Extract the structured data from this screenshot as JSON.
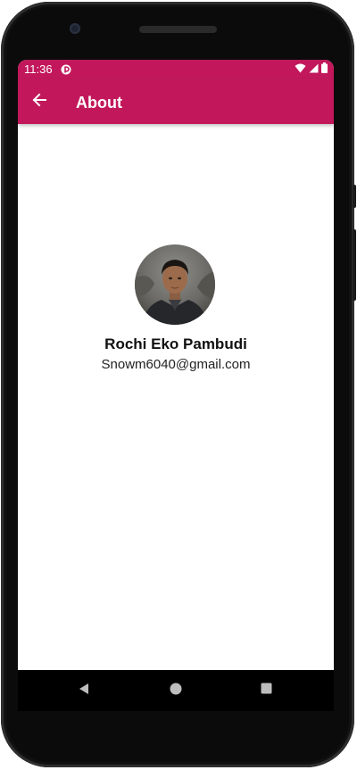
{
  "status_bar": {
    "time": "11:36",
    "app_icon": "notification-app-icon",
    "icons": [
      "wifi-icon",
      "signal-icon",
      "battery-icon"
    ]
  },
  "app_bar": {
    "title": "About",
    "back_icon": "arrow-back-icon"
  },
  "profile": {
    "name": "Rochi Eko Pambudi",
    "email": "Snowm6040@gmail.com"
  },
  "nav_bar": {
    "icons": [
      "back-triangle-icon",
      "home-circle-icon",
      "recents-square-icon"
    ]
  },
  "colors": {
    "primary": "#c2185b",
    "background": "#ffffff",
    "text_primary": "#111111"
  }
}
